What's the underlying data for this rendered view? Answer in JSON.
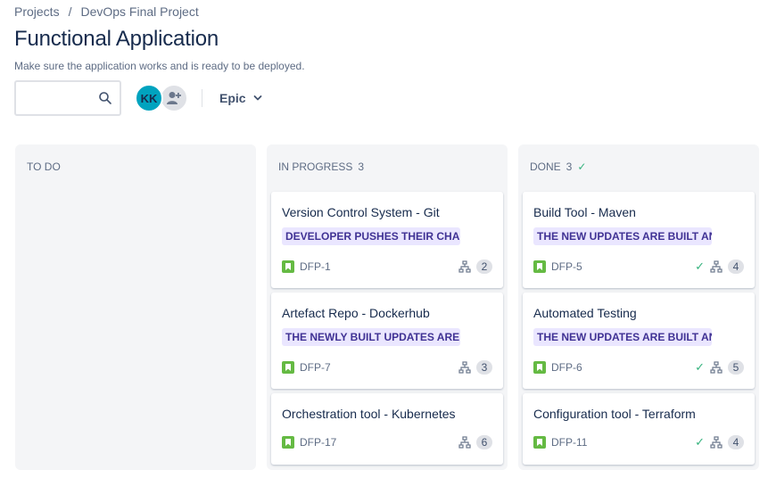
{
  "breadcrumb": {
    "projects": "Projects",
    "separator": "/",
    "project": "DevOps Final Project"
  },
  "header": {
    "title": "Functional Application",
    "description": "Make sure the application works and is ready to be deployed."
  },
  "toolbar": {
    "search_value": "",
    "avatar_initials": "KK",
    "epic_label": "Epic"
  },
  "colors": {
    "epic_bg": "#eae6ff",
    "epic_text": "#403294",
    "story_green": "#65ba43",
    "done_green": "#36b37e",
    "column_bg": "#f4f5f7"
  },
  "columns": [
    {
      "name": "TO DO",
      "count": "",
      "cards": []
    },
    {
      "name": "IN PROGRESS",
      "count": "3",
      "cards": [
        {
          "title": "Version Control System - Git",
          "epic": "DEVELOPER PUSHES THEIR CHAN...",
          "key": "DFP-1",
          "subtasks": "2",
          "done": false
        },
        {
          "title": "Artefact Repo - Dockerhub",
          "epic": "THE NEWLY BUILT UPDATES ARE S...",
          "key": "DFP-7",
          "subtasks": "3",
          "done": false
        },
        {
          "title": "Orchestration tool - Kubernetes",
          "epic": "",
          "key": "DFP-17",
          "subtasks": "6",
          "done": false
        }
      ]
    },
    {
      "name": "DONE",
      "count": "3",
      "cards": [
        {
          "title": "Build Tool - Maven",
          "epic": "THE NEW UPDATES ARE BUILT AN...",
          "key": "DFP-5",
          "subtasks": "4",
          "done": true
        },
        {
          "title": "Automated Testing",
          "epic": "THE NEW UPDATES ARE BUILT AN...",
          "key": "DFP-6",
          "subtasks": "5",
          "done": true
        },
        {
          "title": "Configuration tool - Terraform",
          "epic": "",
          "key": "DFP-11",
          "subtasks": "4",
          "done": true
        }
      ]
    }
  ]
}
